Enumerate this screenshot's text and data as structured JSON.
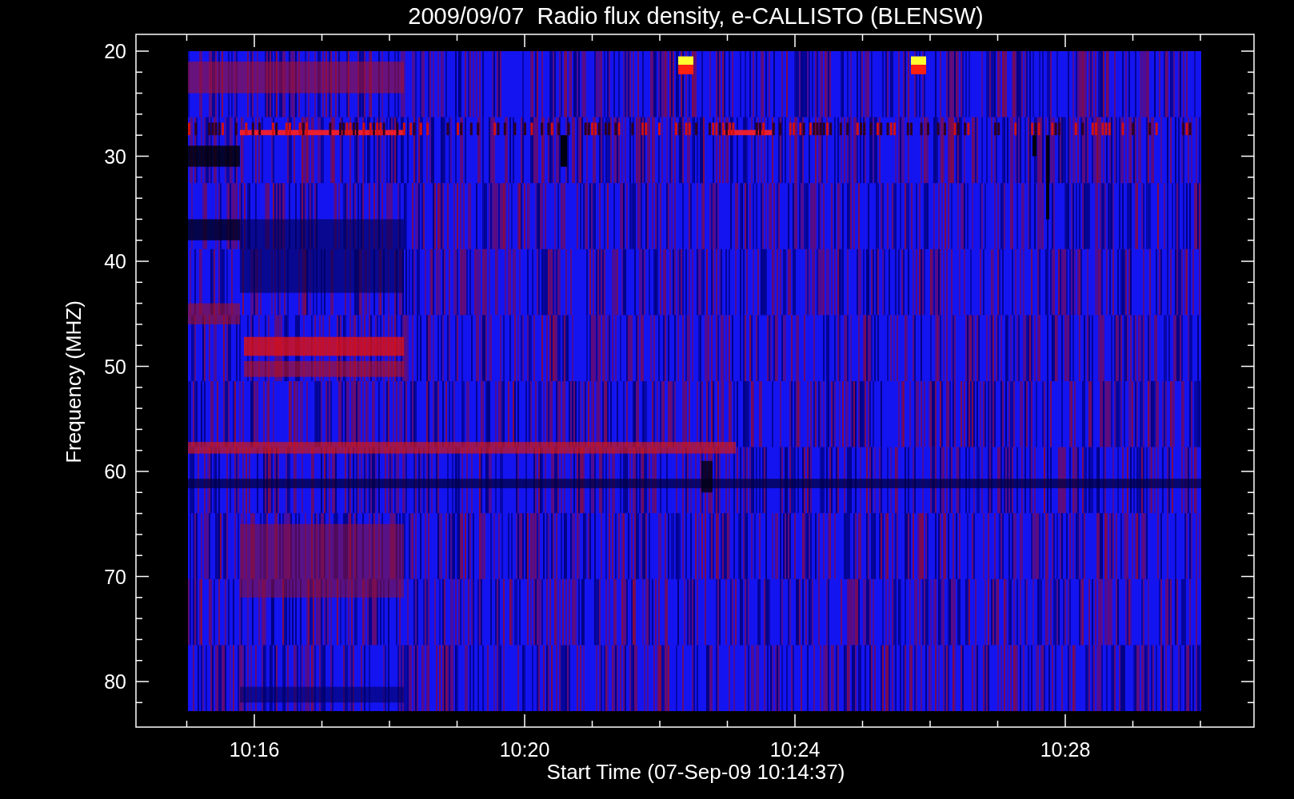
{
  "plot": {
    "title": "2009/09/07  Radio flux density, e-CALLISTO (BLENSW)",
    "ylabel": "Frequency (MHZ)",
    "xlabel": "Start Time (07-Sep-09 10:14:37)",
    "yticks": [
      "20",
      "30",
      "40",
      "50",
      "60",
      "70",
      "80"
    ],
    "xticks": [
      "10:16",
      "10:20",
      "10:24",
      "10:28"
    ]
  }
}
